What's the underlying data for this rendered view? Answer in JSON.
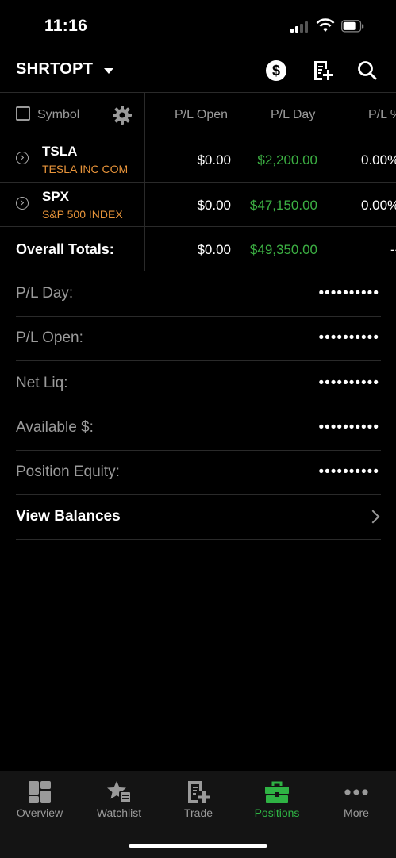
{
  "status_bar": {
    "time": "11:16"
  },
  "header": {
    "account": "SHRTOPT",
    "icons": [
      "dollar-circle-icon",
      "note-add-icon",
      "search-icon"
    ]
  },
  "table": {
    "headers": {
      "symbol": "Symbol",
      "pl_open": "P/L Open",
      "pl_day": "P/L Day",
      "pl_pct": "P/L %"
    },
    "rows": [
      {
        "symbol": "TSLA",
        "description": "TESLA INC COM",
        "pl_open": "$0.00",
        "pl_day": "$2,200.00",
        "pl_pct": "0.00%"
      },
      {
        "symbol": "SPX",
        "description": "S&P 500 INDEX",
        "pl_open": "$0.00",
        "pl_day": "$47,150.00",
        "pl_pct": "0.00%"
      }
    ],
    "totals": {
      "label": "Overall Totals:",
      "pl_open": "$0.00",
      "pl_day": "$49,350.00",
      "pl_pct": "--"
    }
  },
  "balances": [
    {
      "label": "P/L Day:",
      "value": "••••••••••"
    },
    {
      "label": "P/L Open:",
      "value": "••••••••••"
    },
    {
      "label": "Net Liq:",
      "value": "••••••••••"
    },
    {
      "label": "Available $:",
      "value": "••••••••••"
    },
    {
      "label": "Position Equity:",
      "value": "••••••••••"
    }
  ],
  "view_balances": "View Balances",
  "tabs": [
    {
      "label": "Overview",
      "icon": "overview-icon",
      "active": false
    },
    {
      "label": "Watchlist",
      "icon": "watchlist-icon",
      "active": false
    },
    {
      "label": "Trade",
      "icon": "trade-icon",
      "active": false
    },
    {
      "label": "Positions",
      "icon": "briefcase-icon",
      "active": true
    },
    {
      "label": "More",
      "icon": "more-dots-icon",
      "active": false
    }
  ],
  "colors": {
    "accent_green": "#2fb344",
    "gain_green": "#3cb043",
    "desc_orange": "#e8943a",
    "background": "#000000"
  }
}
